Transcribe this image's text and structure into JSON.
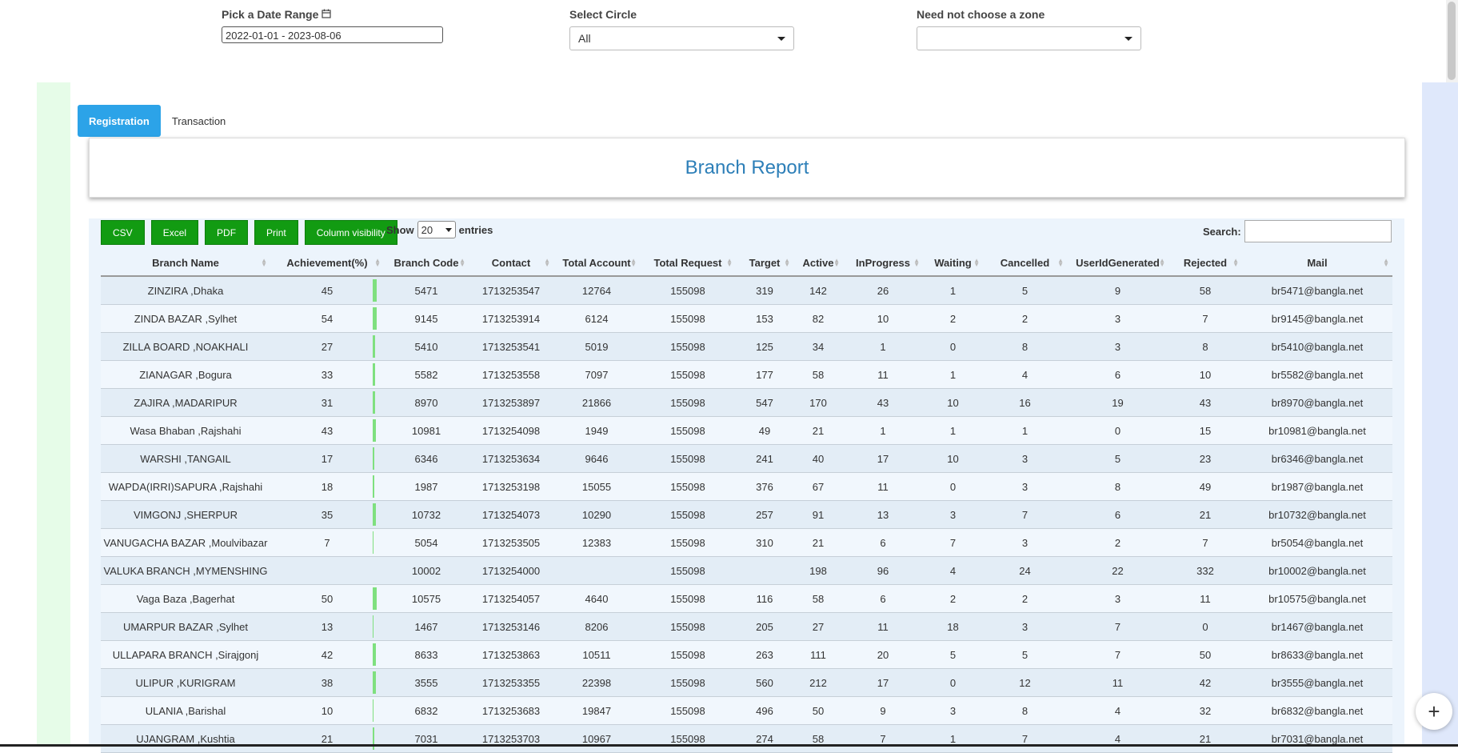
{
  "filters": {
    "date_label": "Pick a Date Range",
    "date_value": "2022-01-01 - 2023-08-06",
    "circle_label": "Select Circle",
    "circle_value": "All",
    "zone_label": "Need not choose a zone",
    "zone_value": ""
  },
  "tabs": [
    "Registration",
    "Transaction"
  ],
  "report_title": "Branch Report",
  "buttons": [
    "CSV",
    "Excel",
    "PDF",
    "Print",
    "Column visibility"
  ],
  "show": {
    "label": "Show",
    "value": "20",
    "suffix": "entries"
  },
  "search_label": "Search:",
  "columns": [
    "Branch Name",
    "Achievement(%)",
    "Branch Code",
    "Contact",
    "Total Account",
    "Total Request",
    "Target",
    "Active",
    "InProgress",
    "Waiting",
    "Cancelled",
    "UserIdGenerated",
    "Rejected",
    "Mail"
  ],
  "rows": [
    [
      "ZINZIRA ,Dhaka",
      "45",
      "5471",
      "1713253547",
      "12764",
      "155098",
      "319",
      "142",
      "26",
      "1",
      "5",
      "9",
      "58",
      "br5471@bangla.net"
    ],
    [
      "ZINDA BAZAR ,Sylhet",
      "54",
      "9145",
      "1713253914",
      "6124",
      "155098",
      "153",
      "82",
      "10",
      "2",
      "2",
      "3",
      "7",
      "br9145@bangla.net"
    ],
    [
      "ZILLA BOARD ,NOAKHALI",
      "27",
      "5410",
      "1713253541",
      "5019",
      "155098",
      "125",
      "34",
      "1",
      "0",
      "8",
      "3",
      "8",
      "br5410@bangla.net"
    ],
    [
      "ZIANAGAR ,Bogura",
      "33",
      "5582",
      "1713253558",
      "7097",
      "155098",
      "177",
      "58",
      "11",
      "1",
      "4",
      "6",
      "10",
      "br5582@bangla.net"
    ],
    [
      "ZAJIRA ,MADARIPUR",
      "31",
      "8970",
      "1713253897",
      "21866",
      "155098",
      "547",
      "170",
      "43",
      "10",
      "16",
      "19",
      "43",
      "br8970@bangla.net"
    ],
    [
      "Wasa Bhaban ,Rajshahi",
      "43",
      "10981",
      "1713254098",
      "1949",
      "155098",
      "49",
      "21",
      "1",
      "1",
      "1",
      "0",
      "15",
      "br10981@bangla.net"
    ],
    [
      "WARSHI ,TANGAIL",
      "17",
      "6346",
      "1713253634",
      "9646",
      "155098",
      "241",
      "40",
      "17",
      "10",
      "3",
      "5",
      "23",
      "br6346@bangla.net"
    ],
    [
      "WAPDA(IRRI)SAPURA ,Rajshahi",
      "18",
      "1987",
      "1713253198",
      "15055",
      "155098",
      "376",
      "67",
      "11",
      "0",
      "3",
      "8",
      "49",
      "br1987@bangla.net"
    ],
    [
      "VIMGONJ ,SHERPUR",
      "35",
      "10732",
      "1713254073",
      "10290",
      "155098",
      "257",
      "91",
      "13",
      "3",
      "7",
      "6",
      "21",
      "br10732@bangla.net"
    ],
    [
      "VANUGACHA BAZAR ,Moulvibazar",
      "7",
      "5054",
      "1713253505",
      "12383",
      "155098",
      "310",
      "21",
      "6",
      "7",
      "3",
      "2",
      "7",
      "br5054@bangla.net"
    ],
    [
      "VALUKA BRANCH ,MYMENSHING",
      "",
      "10002",
      "1713254000",
      "",
      "155098",
      "",
      "198",
      "96",
      "4",
      "24",
      "22",
      "332",
      "br10002@bangla.net"
    ],
    [
      "Vaga Baza ,Bagerhat",
      "50",
      "10575",
      "1713254057",
      "4640",
      "155098",
      "116",
      "58",
      "6",
      "2",
      "2",
      "3",
      "11",
      "br10575@bangla.net"
    ],
    [
      "UMARPUR BAZAR ,Sylhet",
      "13",
      "1467",
      "1713253146",
      "8206",
      "155098",
      "205",
      "27",
      "11",
      "18",
      "3",
      "7",
      "0",
      "br1467@bangla.net"
    ],
    [
      "ULLAPARA BRANCH ,Sirajgonj",
      "42",
      "8633",
      "1713253863",
      "10511",
      "155098",
      "263",
      "111",
      "20",
      "5",
      "5",
      "7",
      "50",
      "br8633@bangla.net"
    ],
    [
      "ULIPUR ,KURIGRAM",
      "38",
      "3555",
      "1713253355",
      "22398",
      "155098",
      "560",
      "212",
      "17",
      "0",
      "12",
      "11",
      "42",
      "br3555@bangla.net"
    ],
    [
      "ULANIA ,Barishal",
      "10",
      "6832",
      "1713253683",
      "19847",
      "155098",
      "496",
      "50",
      "9",
      "3",
      "8",
      "4",
      "32",
      "br6832@bangla.net"
    ],
    [
      "UJANGRAM ,Kushtia",
      "21",
      "7031",
      "1713253703",
      "10967",
      "155098",
      "274",
      "58",
      "7",
      "1",
      "7",
      "4",
      "21",
      "br7031@bangla.net"
    ]
  ],
  "fab_label": "+"
}
